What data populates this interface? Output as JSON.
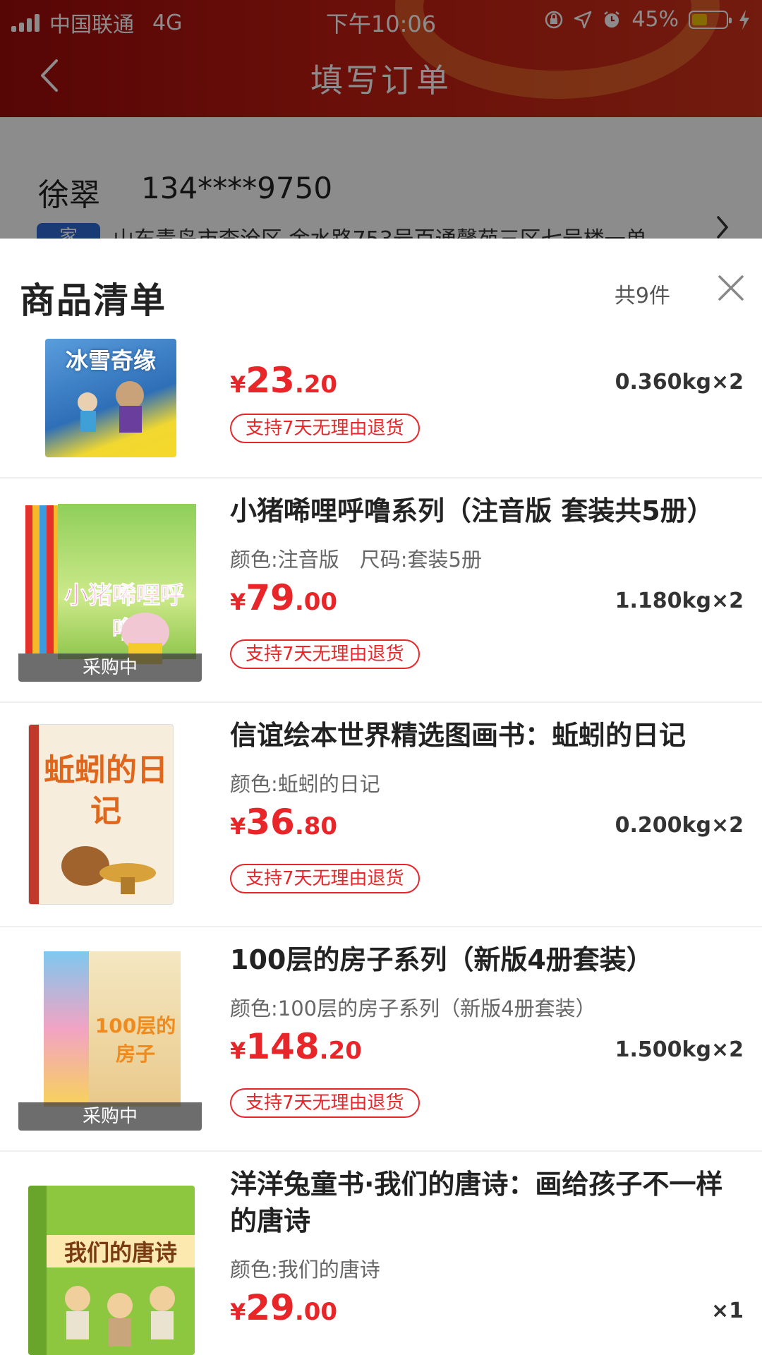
{
  "status_bar": {
    "carrier": "中国联通",
    "network": "4G",
    "time": "下午10:06",
    "battery": "45%",
    "battery_level": 0.45
  },
  "nav": {
    "title": "填写订单"
  },
  "address": {
    "name": "徐翠",
    "phone": "134****9750",
    "tag": "家",
    "text": "山东青岛市李沧区 金水路753号百通馨苑三区七号楼一单"
  },
  "sheet": {
    "title": "商品清单",
    "count": "共9件"
  },
  "products": [
    {
      "title": "冰雪奇缘",
      "cover_text": "冰雪奇缘",
      "spec": "",
      "price_cur": "¥",
      "price_int": "23",
      "price_dec": ".20",
      "weight": "0.360kg×2",
      "return_label": "支持7天无理由退货",
      "badge": ""
    },
    {
      "title": "小猪唏哩呼噜系列（注音版 套装共5册）",
      "cover_text": "小猪唏哩呼噜",
      "spec": "颜色:注音版　尺码:套装5册",
      "price_cur": "¥",
      "price_int": "79",
      "price_dec": ".00",
      "weight": "1.180kg×2",
      "return_label": "支持7天无理由退货",
      "badge": "采购中"
    },
    {
      "title": "信谊绘本世界精选图画书：蚯蚓的日记",
      "cover_text": "蚯蚓的日记",
      "spec": "颜色:蚯蚓的日记",
      "price_cur": "¥",
      "price_int": "36",
      "price_dec": ".80",
      "weight": "0.200kg×2",
      "return_label": "支持7天无理由退货",
      "badge": ""
    },
    {
      "title": "100层的房子系列（新版4册套装）",
      "cover_text": "100层的房子",
      "spec": "颜色:100层的房子系列（新版4册套装）",
      "price_cur": "¥",
      "price_int": "148",
      "price_dec": ".20",
      "weight": "1.500kg×2",
      "return_label": "支持7天无理由退货",
      "badge": "采购中"
    },
    {
      "title": "洋洋兔童书·我们的唐诗：画给孩子不一样的唐诗",
      "cover_text": "我们的唐诗",
      "spec": "颜色:我们的唐诗",
      "price_cur": "¥",
      "price_int": "29",
      "price_dec": ".00",
      "weight": "×1",
      "return_label": "",
      "badge": ""
    }
  ],
  "colors": {
    "accent_red": "#e8262a",
    "header_red": "#c21d12"
  }
}
